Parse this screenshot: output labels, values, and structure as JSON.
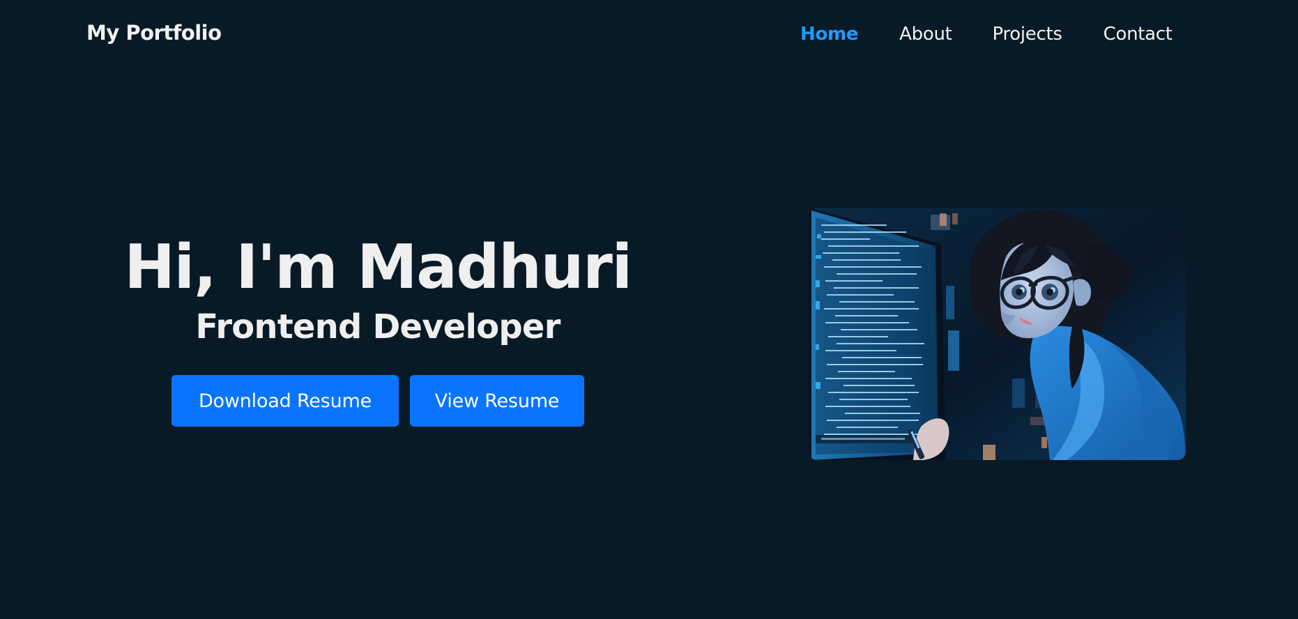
{
  "navbar": {
    "brand": "My Portfolio",
    "links": [
      {
        "label": "Home",
        "active": true
      },
      {
        "label": "About",
        "active": false
      },
      {
        "label": "Projects",
        "active": false
      },
      {
        "label": "Contact",
        "active": false
      }
    ]
  },
  "hero": {
    "title": "Hi, I'm Madhuri",
    "subtitle": "Frontend Developer",
    "buttons": {
      "download_label": "Download Resume",
      "view_label": "View Resume"
    },
    "image": {
      "icon": "developer-illustration",
      "description_icon": "girl-coding-at-monitor"
    }
  },
  "colors": {
    "background": "#091a27",
    "accent": "#1e9bff",
    "button": "#0a74ff",
    "text": "#f2f2f2"
  }
}
